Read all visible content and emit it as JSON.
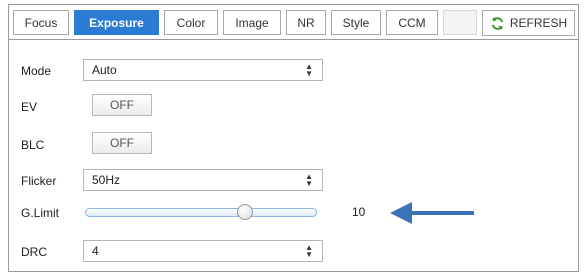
{
  "tabs": [
    {
      "label": "Focus",
      "active": false
    },
    {
      "label": "Exposure",
      "active": true
    },
    {
      "label": "Color",
      "active": false
    },
    {
      "label": "Image",
      "active": false
    },
    {
      "label": "NR",
      "active": false
    },
    {
      "label": "Style",
      "active": false
    },
    {
      "label": "CCM",
      "active": false
    }
  ],
  "refresh": {
    "label": "REFRESH",
    "icon": "refresh-icon",
    "icon_color": "#3a8f2a"
  },
  "accent_color": "#2b7cd3",
  "arrow_color": "#3b73b9",
  "form": {
    "mode": {
      "label": "Mode",
      "value": "Auto"
    },
    "ev": {
      "label": "EV",
      "value": "OFF"
    },
    "blc": {
      "label": "BLC",
      "value": "OFF"
    },
    "flicker": {
      "label": "Flicker",
      "value": "50Hz"
    },
    "glimit": {
      "label": "G.Limit",
      "value": "10",
      "level": 0.69
    },
    "drc": {
      "label": "DRC",
      "value": "4"
    }
  }
}
